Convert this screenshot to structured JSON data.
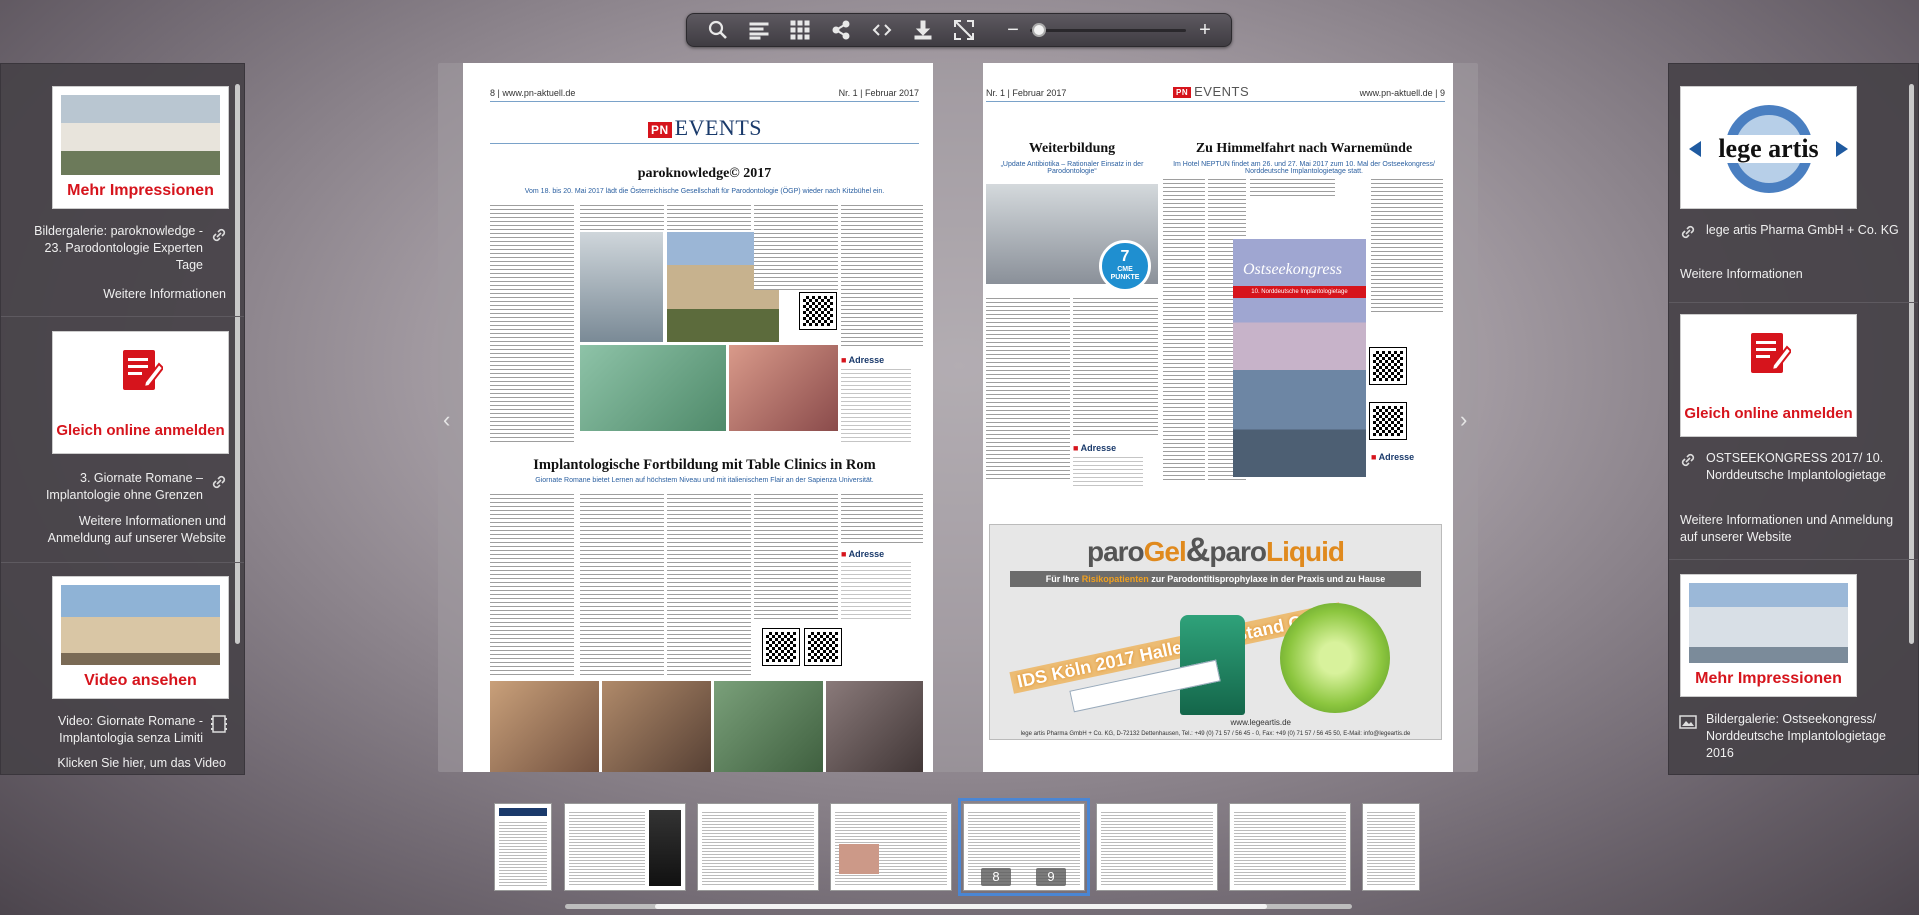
{
  "toolbar": {
    "buttons": [
      "search-icon",
      "table-of-contents-icon",
      "grid-view-icon",
      "share-icon",
      "embed-icon",
      "download-icon",
      "fullscreen-icon"
    ],
    "zoom_minus": "−",
    "zoom_plus": "+",
    "zoom_level": 0
  },
  "left_panel": {
    "items": [
      {
        "cta": "Mehr Impressionen",
        "title": "Bildergalerie: paroknowledge - 23. Parodontologie Experten Tage",
        "link": "Weitere Informationen"
      },
      {
        "cta": "Gleich online anmelden",
        "title": "3. Giornate Romane – Implantologie ohne Grenzen",
        "link": "Weitere Informationen und Anmeldung auf unserer Website"
      },
      {
        "cta": "Video ansehen",
        "title": "Video: Giornate Romane - Implantologia senza Limiti",
        "link": "Klicken Sie hier, um das Video"
      }
    ]
  },
  "right_panel": {
    "items": [
      {
        "logo": "lege artis",
        "title": "lege artis Pharma GmbH + Co. KG",
        "link": "Weitere Informationen"
      },
      {
        "cta": "Gleich online anmelden",
        "title": "OSTSEEKONGRESS 2017/ 10. Norddeutsche Implantologietage",
        "link": "Weitere Informationen und Anmeldung auf unserer Website"
      },
      {
        "cta": "Mehr Impressionen",
        "title": "Bildergalerie: Ostseekongress/ Norddeutsche Implantologietage 2016"
      }
    ]
  },
  "left_page": {
    "header_left": "8 | www.pn-aktuell.de",
    "header_right": "Nr. 1 | Februar 2017",
    "section_logo": "PN",
    "section": "EVENTS",
    "article1_title": "paroknowledge© 2017",
    "article1_sub": "Vom 18. bis 20. Mai 2017 lädt die Österreichische Gesellschaft für Parodontologie (ÖGP) wieder nach Kitzbühel ein.",
    "adresse": "Adresse",
    "article2_title": "Implantologische Fortbildung mit Table Clinics in Rom",
    "article2_sub": "Giornate Romane bietet Lernen auf höchstem Niveau und mit italienischem Flair an der Sapienza Universität."
  },
  "right_page": {
    "header_left": "Nr. 1 | Februar 2017",
    "header_right": "www.pn-aktuell.de | 9",
    "section_logo": "PN",
    "section": "EVENTS",
    "article1_title": "Weiterbildung",
    "article1_sub": "„Update Antibiotika – Rationaler Einsatz in der Parodontologie“",
    "cme": "CME PUNKTE",
    "cme_num": "7",
    "article2_title": "Zu Himmelfahrt nach Warnemünde",
    "article2_sub": "Im Hotel NEPTUN findet am 26. und 27. Mai 2017 zum 10. Mal der Ostseekongress/ Norddeutsche Implantologietage statt.",
    "poster_title": "Ostseekongress",
    "poster_sub": "10. Norddeutsche Implantologietage",
    "adresse": "Adresse",
    "ad_brand_1": "paro",
    "ad_brand_gel": "Gel",
    "ad_brand_amp": "&",
    "ad_brand_2": "paro",
    "ad_brand_liquid": "Liquid",
    "ad_tag_1": "Für Ihre ",
    "ad_tag_hl": "Risikopatienten",
    "ad_tag_2": " zur Parodontitisprophylaxe in der Praxis und zu Hause",
    "ad_ids": "IDS Köln 2017 Halle 11.2 | Stand O 011",
    "ad_url": "www.legeartis.de",
    "ad_footer": "lege artis Pharma GmbH + Co. KG, D-72132 Dettenhausen, Tel.: +49 (0) 71 57 / 56 45 - 0, Fax: +49 (0) 71 57 / 56 45 50, E-Mail: info@legeartis.de"
  },
  "thumbnails": {
    "active_left": "8",
    "active_right": "9"
  }
}
